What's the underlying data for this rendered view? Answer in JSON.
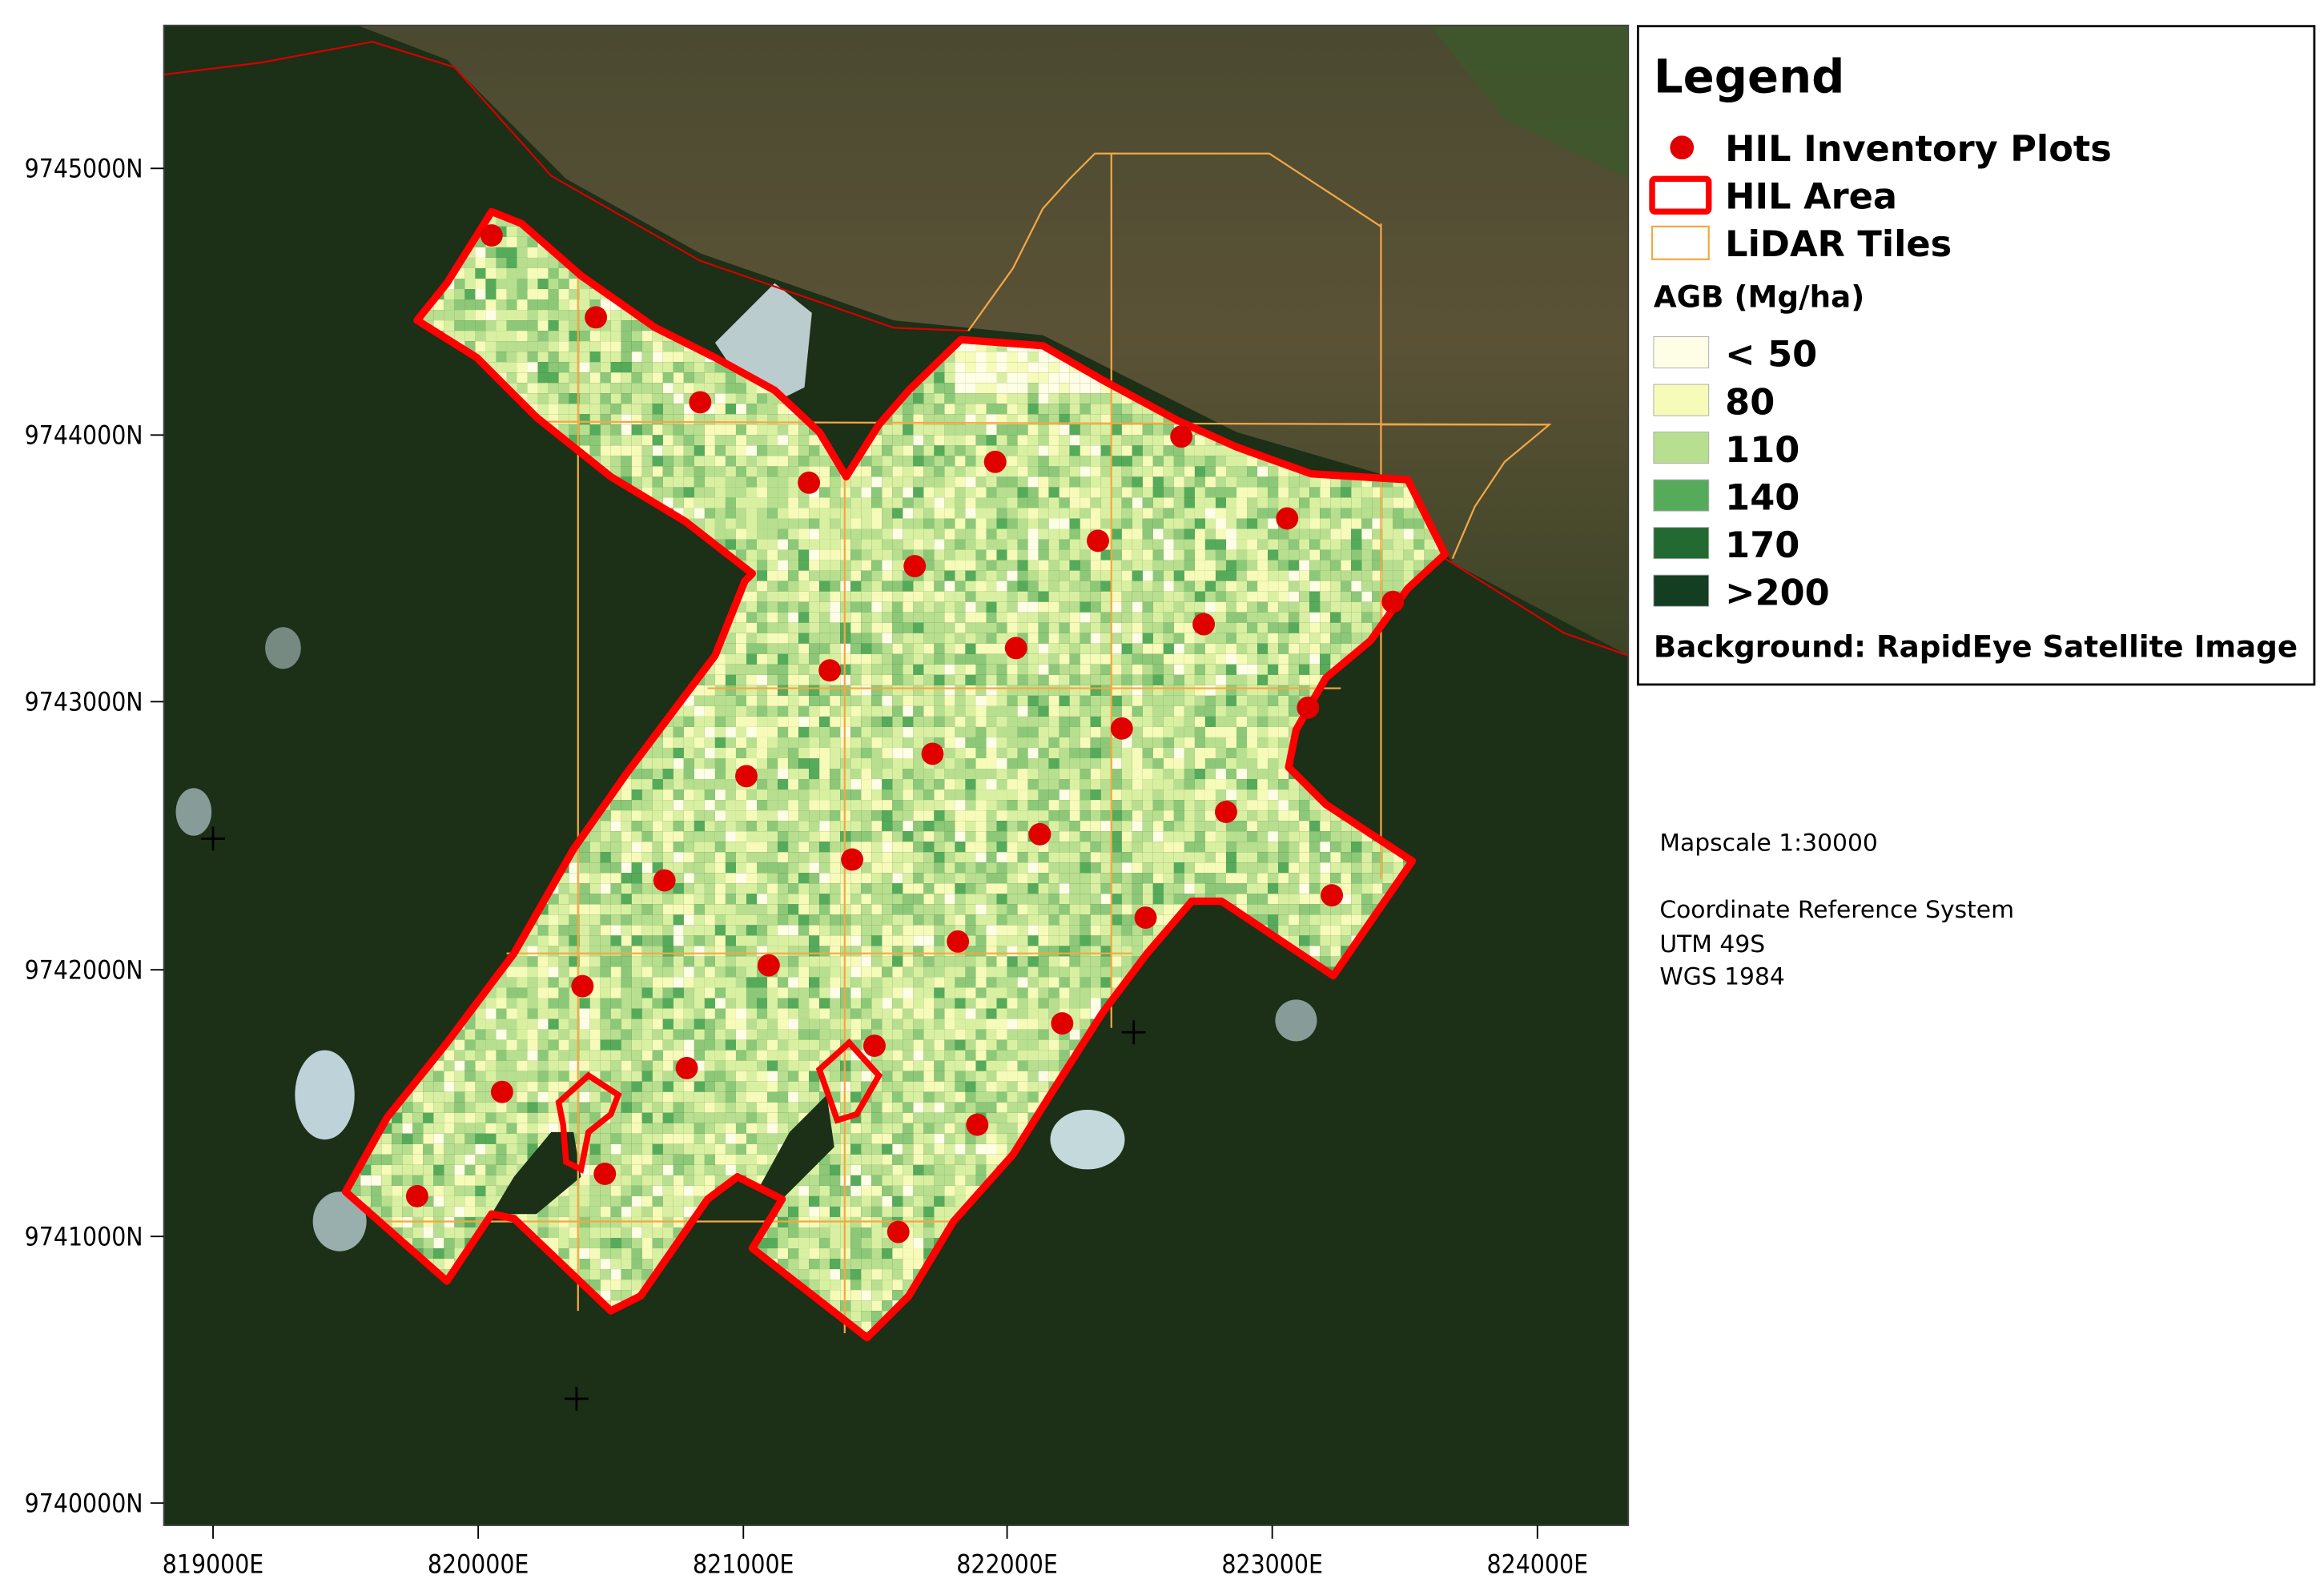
{
  "map": {
    "x_ticks": [
      "819000E",
      "820000E",
      "821000E",
      "822000E",
      "823000E",
      "824000E"
    ],
    "y_ticks": [
      "9745000N",
      "9744000N",
      "9743000N",
      "9742000N",
      "9741000N",
      "9740000N"
    ]
  },
  "legend": {
    "title": "Legend",
    "items": [
      {
        "label": "HIL Inventory Plots",
        "symbol": "point",
        "color": "#e00000"
      },
      {
        "label": "HIL Area",
        "symbol": "polygon-outline",
        "color": "#ff0000"
      },
      {
        "label": "LiDAR Tiles",
        "symbol": "polygon-outline",
        "color": "#f5a742"
      }
    ],
    "agb_title": "AGB (Mg/ha)",
    "agb_classes": [
      {
        "label": "< 50",
        "color": "#fefee6"
      },
      {
        "label": "80",
        "color": "#f7fbb9"
      },
      {
        "label": "110",
        "color": "#b7df8f"
      },
      {
        "label": "140",
        "color": "#56ab5a"
      },
      {
        "label": "170",
        "color": "#236932"
      },
      {
        "label": ">200",
        "color": "#143e22"
      }
    ],
    "background_note": "Background: RapidEye Satellite Image"
  },
  "info": {
    "mapscale": "Mapscale 1:30000",
    "crs_title": "Coordinate Reference System",
    "crs_projection": "UTM 49S",
    "crs_datum": "WGS 1984"
  }
}
